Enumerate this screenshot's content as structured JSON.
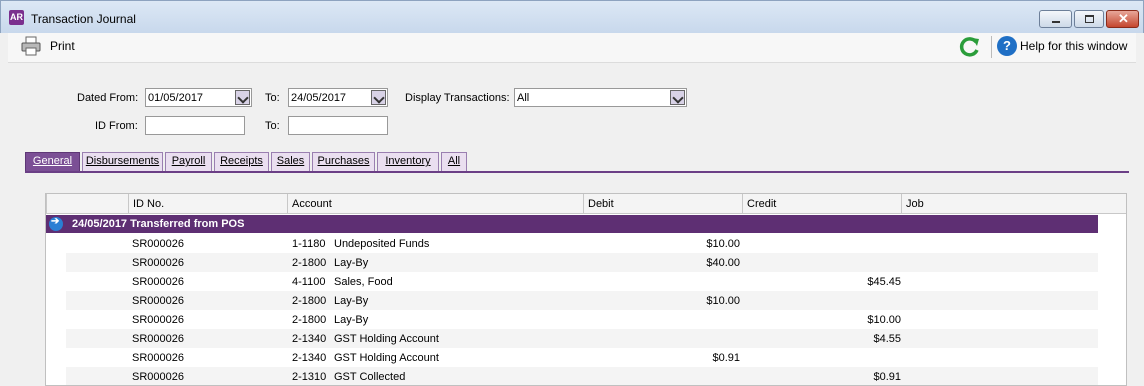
{
  "window": {
    "logo": "AR",
    "title": "Transaction Journal"
  },
  "toolbar": {
    "print_label": "Print",
    "help_label": "Help for this window"
  },
  "filters": {
    "dated_from_label": "Dated From:",
    "dated_from": "01/05/2017",
    "dated_to_label": "To:",
    "dated_to": "24/05/2017",
    "display_label": "Display Transactions:",
    "display_value": "All",
    "id_from_label": "ID From:",
    "id_from": "",
    "id_to_label": "To:",
    "id_to": ""
  },
  "tabs": [
    "General",
    "Disbursements",
    "Payroll",
    "Receipts",
    "Sales",
    "Purchases",
    "Inventory",
    "All"
  ],
  "table": {
    "headers": [
      "ID No.",
      "Account",
      "Debit",
      "Credit",
      "Job"
    ],
    "group": "24/05/2017  Transferred from POS",
    "rows": [
      [
        "SR000026",
        "1-1180",
        "Undeposited Funds",
        "$10.00",
        "",
        ""
      ],
      [
        "SR000026",
        "2-1800",
        "Lay-By",
        "$40.00",
        "",
        ""
      ],
      [
        "SR000026",
        "4-1100",
        "Sales, Food",
        "",
        "$45.45",
        ""
      ],
      [
        "SR000026",
        "2-1800",
        "Lay-By",
        "$10.00",
        "",
        ""
      ],
      [
        "SR000026",
        "2-1800",
        "Lay-By",
        "",
        "$10.00",
        ""
      ],
      [
        "SR000026",
        "2-1340",
        "GST Holding Account",
        "",
        "$4.55",
        ""
      ],
      [
        "SR000026",
        "2-1340",
        "GST Holding Account",
        "$0.91",
        "",
        ""
      ],
      [
        "SR000026",
        "2-1310",
        "GST Collected",
        "",
        "$0.91",
        ""
      ]
    ]
  }
}
